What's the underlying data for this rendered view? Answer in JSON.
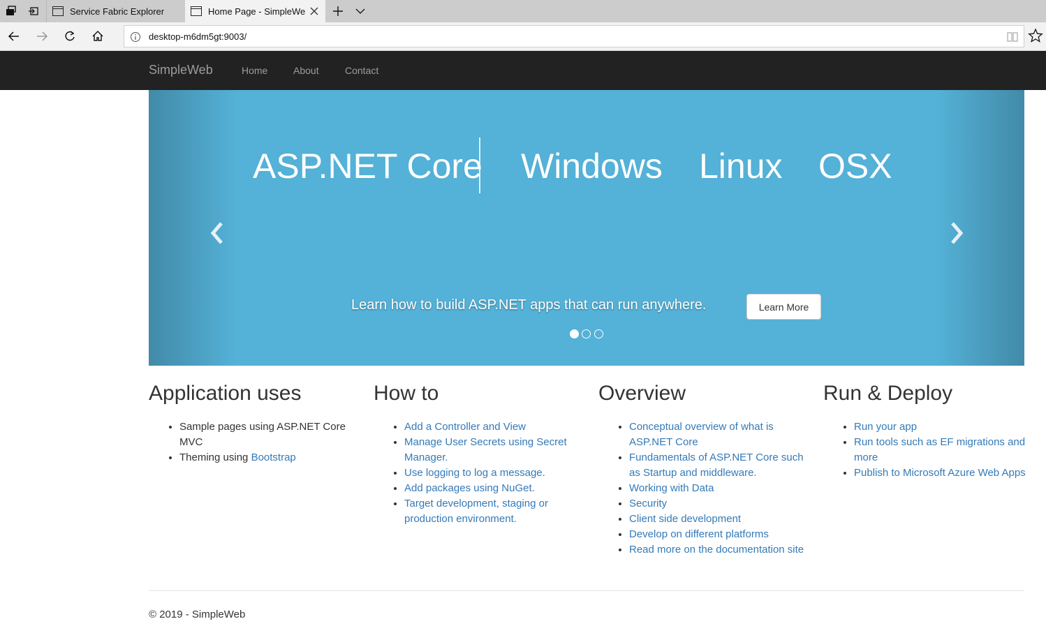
{
  "browser": {
    "tabs": [
      {
        "title": "Service Fabric Explorer",
        "active": false
      },
      {
        "title": "Home Page - SimpleWe",
        "active": true
      }
    ],
    "url": "desktop-m6dm5gt:9003/"
  },
  "site": {
    "brand": "SimpleWeb",
    "nav": [
      "Home",
      "About",
      "Contact"
    ]
  },
  "carousel": {
    "words": [
      "ASP.NET Core",
      "Windows",
      "Linux",
      "OSX"
    ],
    "caption": "Learn how to build ASP.NET apps that can run anywhere.",
    "button": "Learn More",
    "active_slide": 1,
    "slide_count": 3,
    "background_color": "#54b1d7"
  },
  "columns": [
    {
      "heading": "Application uses",
      "items": [
        {
          "text": "Sample pages using ASP.NET Core MVC"
        },
        {
          "text": "Theming using ",
          "link": "Bootstrap"
        }
      ]
    },
    {
      "heading": "How to",
      "items": [
        {
          "link": "Add a Controller and View"
        },
        {
          "link": "Manage User Secrets using Secret Manager."
        },
        {
          "link": "Use logging to log a message."
        },
        {
          "link": "Add packages using NuGet."
        },
        {
          "link": "Target development, staging or production environment."
        }
      ]
    },
    {
      "heading": "Overview",
      "items": [
        {
          "link": "Conceptual overview of what is ASP.NET Core"
        },
        {
          "link": "Fundamentals of ASP.NET Core such as Startup and middleware."
        },
        {
          "link": "Working with Data"
        },
        {
          "link": "Security"
        },
        {
          "link": "Client side development"
        },
        {
          "link": "Develop on different platforms"
        },
        {
          "link": "Read more on the documentation site"
        }
      ]
    },
    {
      "heading": "Run & Deploy",
      "items": [
        {
          "link": "Run your app"
        },
        {
          "link": "Run tools such as EF migrations and more"
        },
        {
          "link": "Publish to Microsoft Azure Web Apps"
        }
      ]
    }
  ],
  "footer": "© 2019 - SimpleWeb",
  "colors": {
    "navbar": "#222222",
    "link": "#337ab7",
    "brand_text": "#9d9d9d"
  }
}
